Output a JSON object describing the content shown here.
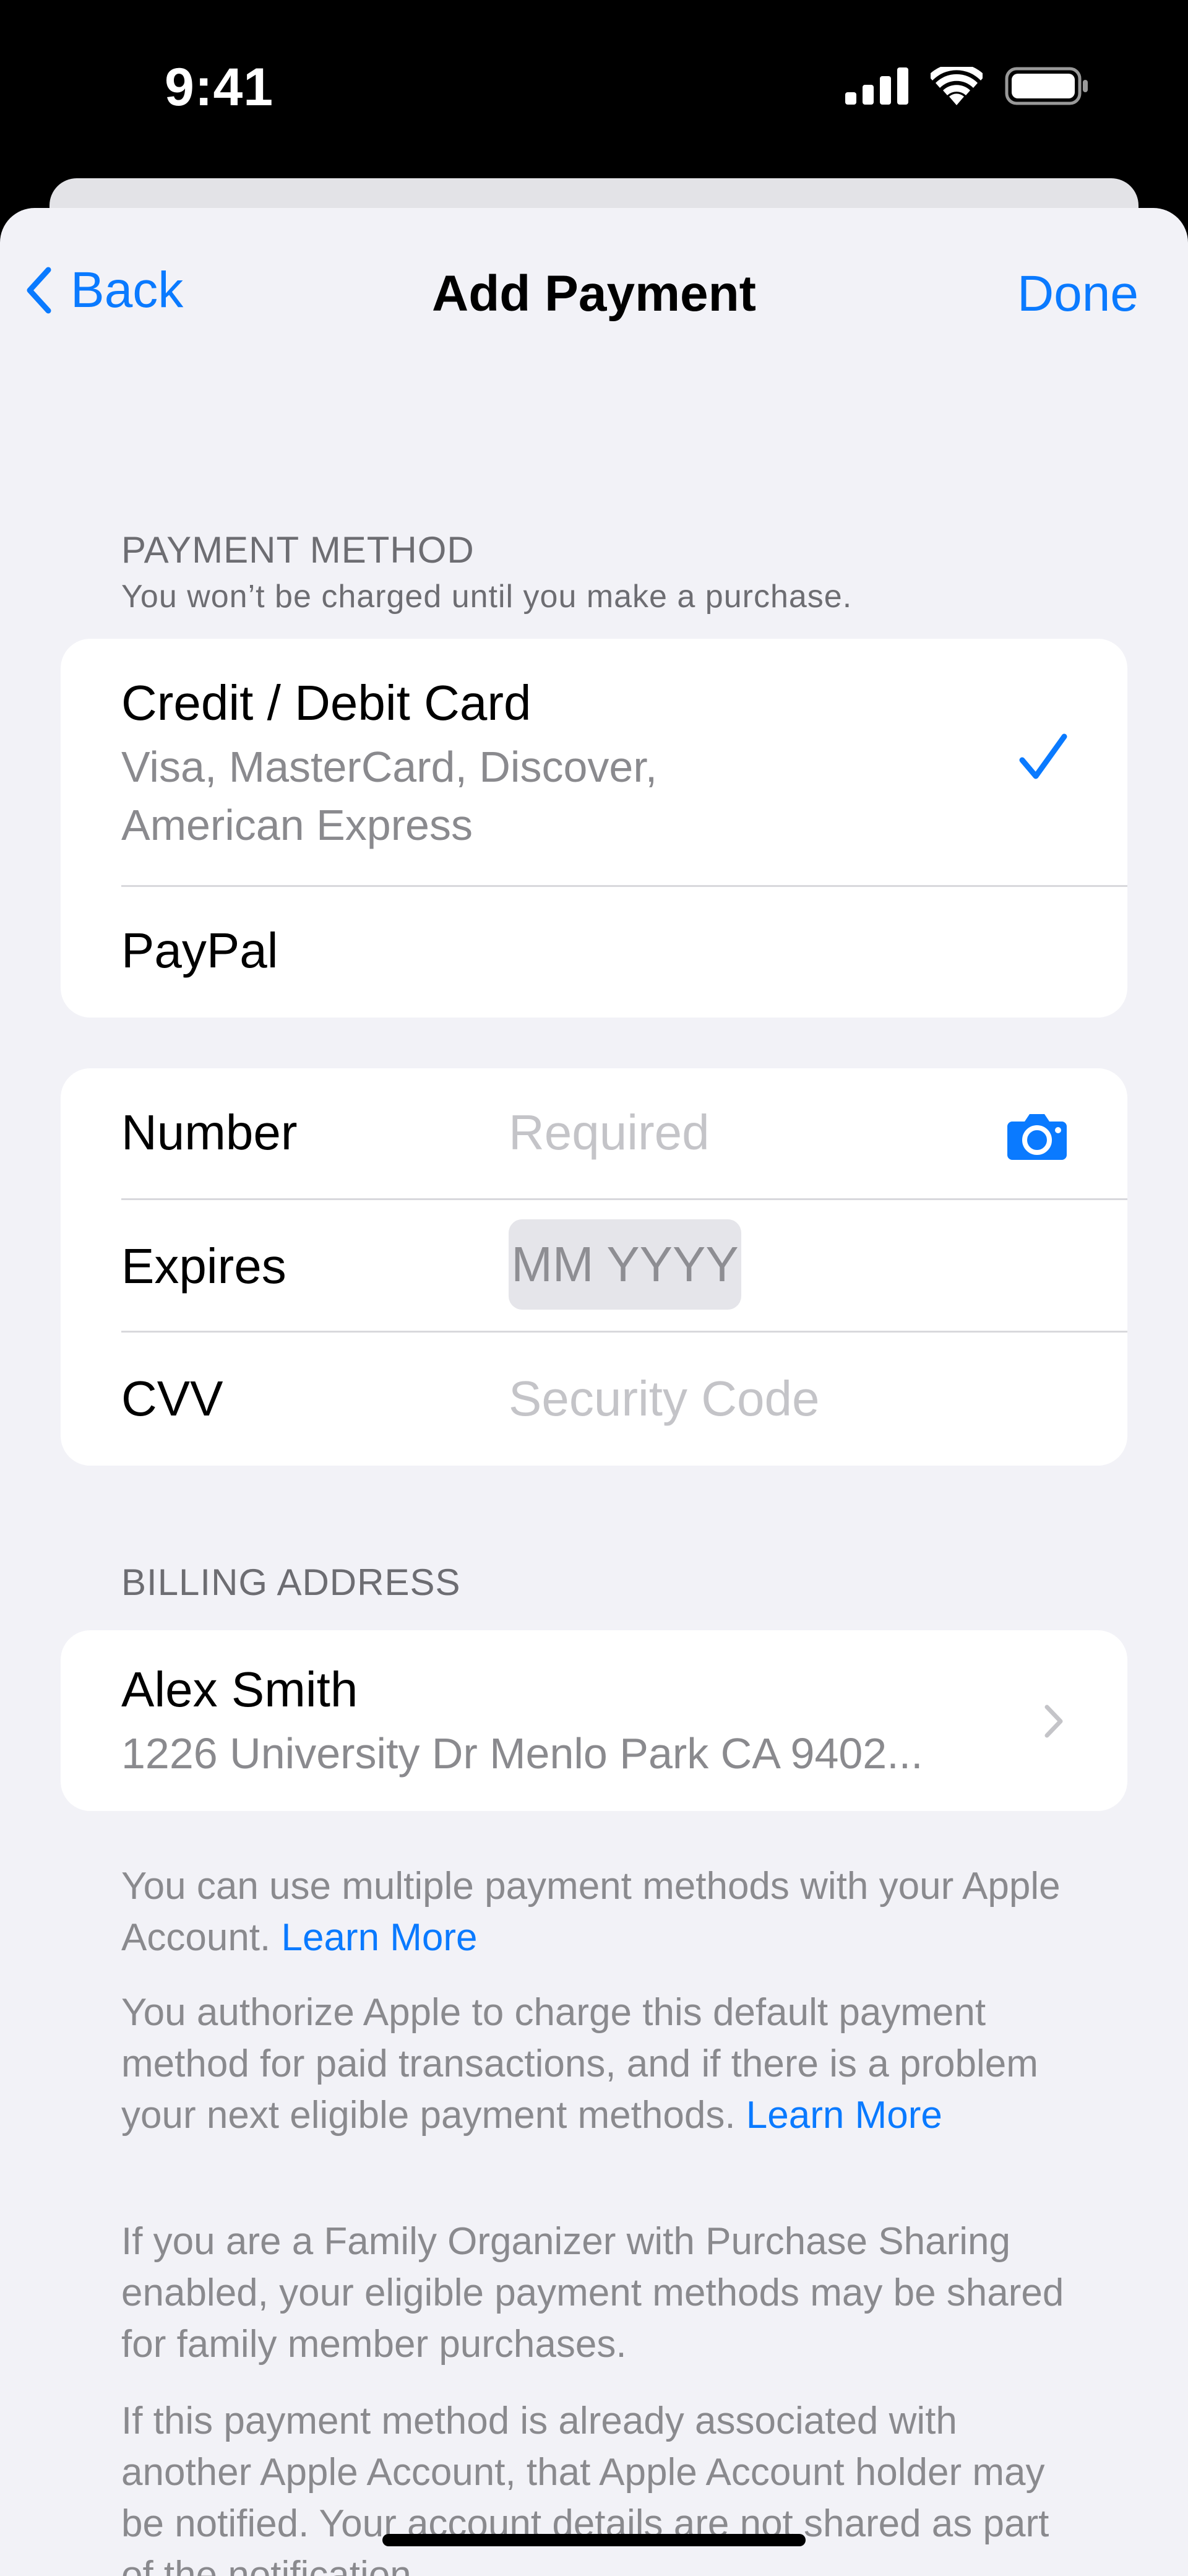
{
  "status_bar": {
    "time": "9:41"
  },
  "nav": {
    "back_label": "Back",
    "title": "Add Payment",
    "done_label": "Done"
  },
  "payment_method": {
    "header": "PAYMENT METHOD",
    "subheader": "You won’t be charged until you make a purchase.",
    "options": [
      {
        "title": "Credit / Debit Card",
        "subtitle_line1": "Visa, MasterCard, Discover,",
        "subtitle_line2": "American Express",
        "selected": true
      },
      {
        "title": "PayPal",
        "selected": false
      }
    ]
  },
  "card_fields": {
    "number_label": "Number",
    "number_placeholder": "Required",
    "expires_label": "Expires",
    "expires_placeholder": "MM YYYY",
    "cvv_label": "CVV",
    "cvv_placeholder": "Security Code"
  },
  "billing": {
    "header": "BILLING ADDRESS",
    "name": "Alex Smith",
    "address": "1226 University Dr Menlo Park CA 9402..."
  },
  "footer": {
    "para1_text": "You can use multiple payment methods with your Apple Account.",
    "para1_link": "Learn More",
    "para2_text": "You authorize Apple to charge this default payment method for paid transactions, and if there is a problem your next eligible payment methods.",
    "para2_link": "Learn More",
    "para3_text": "If you are a Family Organizer with Purchase Sharing enabled, your eligible payment methods may be shared for family member purchases.",
    "para4_text": "If this payment method is already associated with another Apple Account, that Apple Account holder may be notified. Your account details are not shared as part of the notification."
  },
  "colors": {
    "accent": "#0a7aff",
    "background": "#f2f2f7",
    "card": "#ffffff",
    "secondary_text": "#8a8a8e"
  },
  "icons": {
    "back": "chevron-left-icon",
    "checkmark": "checkmark-icon",
    "camera": "camera-icon",
    "disclosure": "chevron-right-icon",
    "cellular": "cellular-signal-icon",
    "wifi": "wifi-icon",
    "battery": "battery-icon"
  }
}
